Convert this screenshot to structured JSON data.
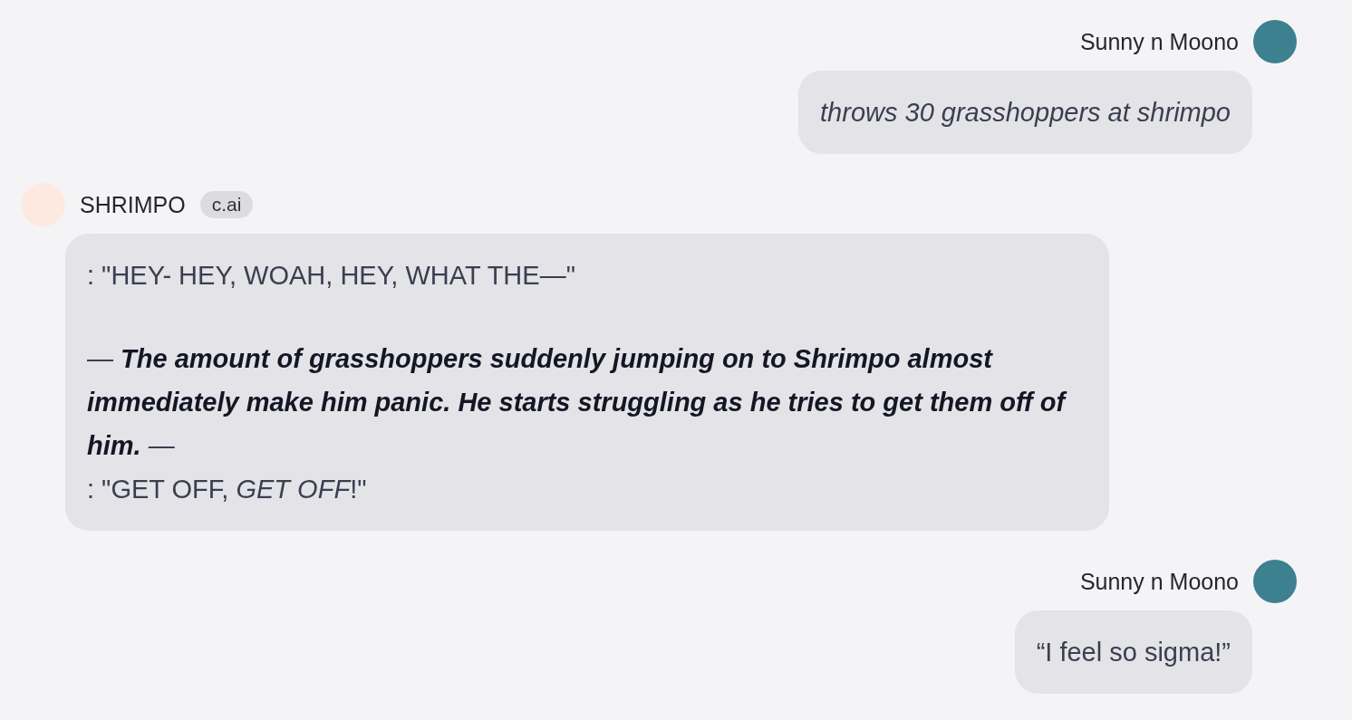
{
  "messages": [
    {
      "kind": "user",
      "name": "Sunny n Moono",
      "italic": true,
      "paragraphs": [
        "throws 30 grasshoppers at shrimpo"
      ]
    },
    {
      "kind": "bot",
      "name": "SHRIMPO",
      "badge": "c.ai",
      "italic": false,
      "paragraphs": [
        ": \"HEY- HEY, WOAH, HEY, WHAT THE—\"",
        "— **The amount of grasshoppers suddenly jumping on to Shrimpo almost immediately make him panic. He starts struggling as he tries to get them off of him.** —",
        ": \"GET OFF, *GET OFF*!\""
      ]
    },
    {
      "kind": "user",
      "name": "Sunny n Moono",
      "italic": false,
      "paragraphs": [
        "“I feel so sigma!”"
      ]
    }
  ]
}
